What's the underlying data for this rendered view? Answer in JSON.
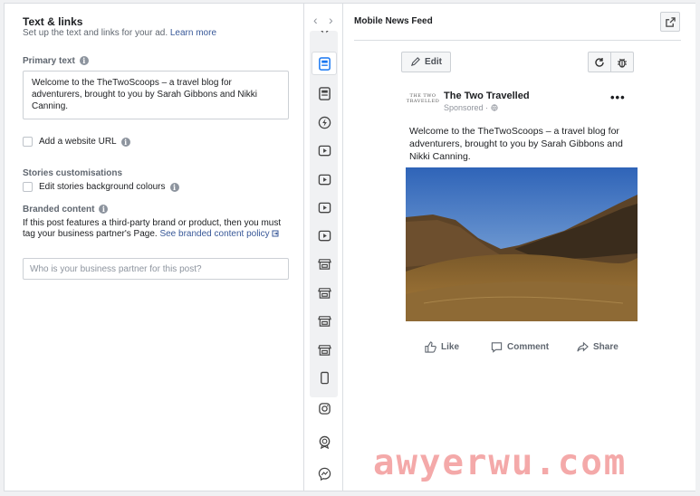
{
  "left": {
    "section_title": "Text & links",
    "section_subtitle": "Set up the text and links for your ad.",
    "learn_more": "Learn more",
    "primary_text_label": "Primary text",
    "primary_text_value": "Welcome to the TheTwoScoops – a travel blog for adventurers, brought to you by Sarah Gibbons and Nikki Canning.",
    "add_website_url": "Add a website URL",
    "stories_label": "Stories customisations",
    "edit_stories_bg": "Edit stories background colours",
    "branded_label": "Branded content",
    "branded_desc": "If this post features a third-party brand or product, then you must tag your business partner's Page.",
    "branded_link": "See branded content policy",
    "partner_placeholder": "Who is your business partner for this post?"
  },
  "strip": {
    "icons": [
      "feed-icon",
      "column-icon",
      "instant-article-icon",
      "video-icon",
      "video-icon",
      "video-icon",
      "video-icon",
      "marketplace-icon",
      "marketplace-icon",
      "marketplace-icon",
      "marketplace-icon",
      "phone-icon",
      "instagram-icon",
      "audience-network-icon",
      "messenger-icon"
    ]
  },
  "preview": {
    "title": "Mobile News Feed",
    "edit_label": "Edit",
    "avatar_text": "THE TWO TRAVELLED",
    "page_name": "The Two Travelled",
    "sponsored": "Sponsored ·",
    "post_text": "Welcome to the TheTwoScoops – a travel blog for adventurers, brought to you by Sarah Gibbons and Nikki Canning.",
    "like": "Like",
    "comment": "Comment",
    "share": "Share"
  },
  "watermark": "awyerwu.com",
  "colors": {
    "link": "#385898",
    "selected_icon": "#1877f2",
    "watermark": "#f4a9a9"
  }
}
